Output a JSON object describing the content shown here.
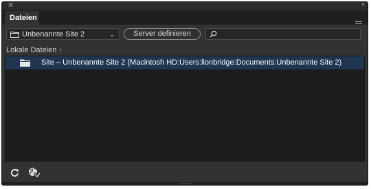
{
  "window": {
    "close_glyph": "✕",
    "collapse_glyph": "‹‹"
  },
  "panel": {
    "tab_title": "Dateien",
    "menu_icon": "hamburger-icon"
  },
  "toolbar": {
    "site_select_value": "Unbenannte Site 2",
    "server_button_label": "Server definieren",
    "search_placeholder": ""
  },
  "files_header": {
    "label": "Lokale Dateien",
    "sort_glyph": "↑"
  },
  "file_rows": [
    {
      "label": "Site – Unbenannte Site 2 (Macintosh HD:Users:lionbridge:Documents:Unbenannte Site 2)",
      "icon": "folder-icon",
      "selected": true
    }
  ],
  "footer": {
    "refresh_icon": "refresh-icon",
    "globe_icon": "globe-check-icon"
  },
  "colors": {
    "selection": "#1f3550",
    "panel_bg": "#323232",
    "list_bg": "#1c1c1c"
  }
}
